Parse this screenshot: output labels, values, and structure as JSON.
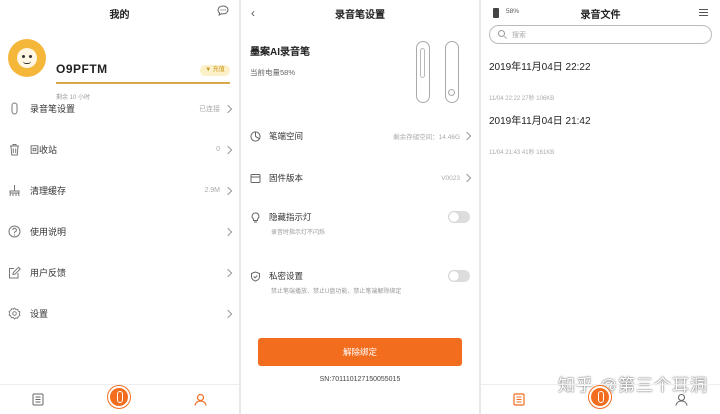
{
  "panel_profile": {
    "title": "我的",
    "username": "O9PFTM",
    "badge": "充值",
    "remaining": "剩余 10 小时",
    "menu": [
      {
        "label": "录音笔设置",
        "value": "已连接"
      },
      {
        "label": "回收站",
        "value": "0"
      },
      {
        "label": "清理缓存",
        "value": "2.9M"
      },
      {
        "label": "使用说明",
        "value": ""
      },
      {
        "label": "用户反馈",
        "value": ""
      },
      {
        "label": "设置",
        "value": ""
      }
    ]
  },
  "panel_settings": {
    "title": "录音笔设置",
    "back": "‹",
    "device_name": "墨案AI录音笔",
    "battery": "当前电量58%",
    "rows": [
      {
        "label": "笔端空间",
        "value": "剩余存储空间：14.46G"
      },
      {
        "label": "固件版本",
        "value": "V0023"
      },
      {
        "label": "隐藏指示灯",
        "sub": "录音时指示灯不闪烁"
      },
      {
        "label": "私密设置",
        "sub": "禁止笔端播放、禁止U盘功能、禁止笔端解除绑定"
      }
    ],
    "unbind": "解除绑定",
    "sn": "SN:701110127150055015"
  },
  "panel_files": {
    "title": "录音文件",
    "battery_pct": "58%",
    "search_placeholder": "搜索",
    "recordings": [
      {
        "datetime": "2019年11月04日 22:22",
        "meta": "11/04 22:22  27秒  106KB"
      },
      {
        "datetime": "2019年11月04日 21:42",
        "meta": "11/04 21:43  41秒  161KB"
      }
    ],
    "watermark": "知乎 @第三个耳洞"
  },
  "colors": {
    "accent": "#f36d1e",
    "gold": "#d7a94c",
    "avatar": "#f5b73a"
  }
}
